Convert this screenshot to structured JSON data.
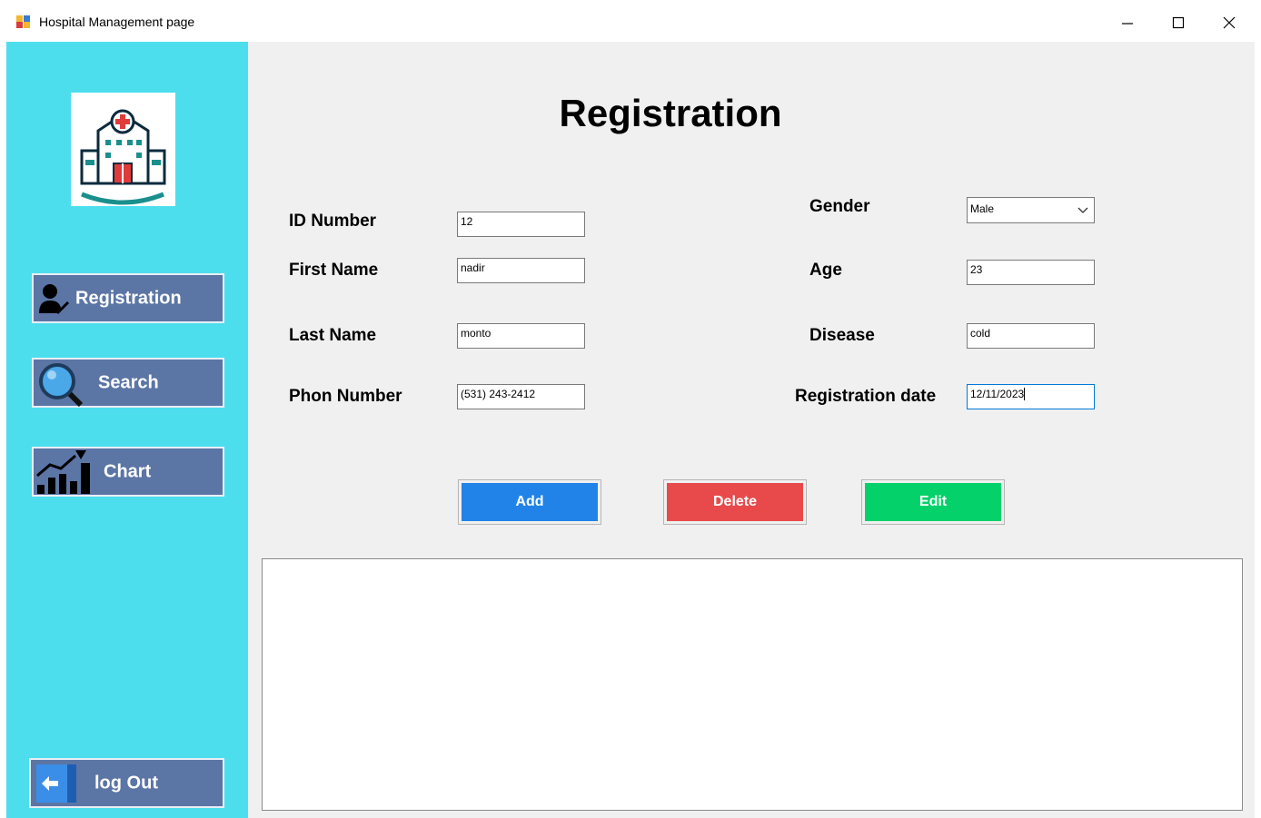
{
  "window": {
    "title": "Hospital Management page",
    "icon": "app-window-icon",
    "controls": [
      "minimize-icon",
      "maximize-icon",
      "close-icon"
    ]
  },
  "sidebar": {
    "logo": "hospital-logo-icon",
    "nav": {
      "registration": "Registration",
      "search": "Search",
      "chart": "Chart",
      "logout": "log Out"
    }
  },
  "page": {
    "title": "Registration"
  },
  "form": {
    "id_number": {
      "label": "ID Number",
      "value": "12"
    },
    "first_name": {
      "label": "First Name",
      "value": "nadir"
    },
    "last_name": {
      "label": "Last Name",
      "value": "monto"
    },
    "phone": {
      "label": "Phon Number",
      "value": "(531) 243-2412"
    },
    "gender": {
      "label": "Gender",
      "value": "Male"
    },
    "age": {
      "label": "Age",
      "value": "23"
    },
    "disease": {
      "label": "Disease",
      "value": "cold"
    },
    "reg_date": {
      "label": "Registration date",
      "value": "12/11/2023"
    }
  },
  "actions": {
    "add": "Add",
    "delete": "Delete",
    "edit": "Edit"
  },
  "colors": {
    "sidebar_bg": "#4ddeee",
    "nav_button": "#5b75a5",
    "add": "#2183e8",
    "delete": "#e84a4c",
    "edit": "#05d16a"
  }
}
